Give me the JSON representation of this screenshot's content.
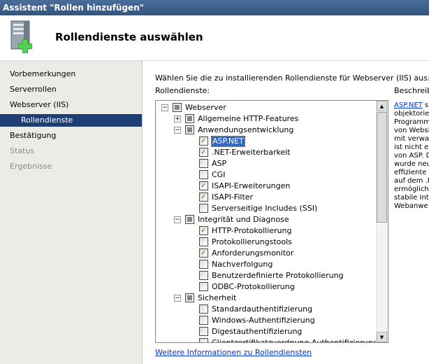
{
  "window": {
    "title": "Assistent \"Rollen hinzufügen\""
  },
  "header": {
    "title": "Rollendienste auswählen",
    "icon": "server-add-icon"
  },
  "sidebar": {
    "items": [
      {
        "label": "Vorbemerkungen",
        "state": "normal"
      },
      {
        "label": "Serverrollen",
        "state": "normal"
      },
      {
        "label": "Webserver (IIS)",
        "state": "normal"
      },
      {
        "label": "Rollendienste",
        "state": "selected"
      },
      {
        "label": "Bestätigung",
        "state": "normal"
      },
      {
        "label": "Status",
        "state": "disabled"
      },
      {
        "label": "Ergebnisse",
        "state": "disabled"
      }
    ]
  },
  "main": {
    "instruction": "Wählen Sie die zu installierenden Rollendienste für Webserver (IIS) aus:",
    "services_label": "Rollendienste:",
    "description_label": "Beschreib",
    "description_link": "ASP.NET",
    "description_lines": [
      " s",
      "objektorie",
      "Programm",
      "von Websi",
      "mit verwa",
      "ist nicht e",
      "von ASP. D",
      "wurde neu",
      "effiziente",
      "auf dem .N",
      "ermöglich",
      "stabile Int",
      "Webanwe"
    ],
    "more_info_link": "Weitere Informationen zu Rollendiensten"
  },
  "tree": [
    {
      "label": "Webserver",
      "level": 0,
      "expander": "−",
      "check": "partial"
    },
    {
      "label": "Allgemeine HTTP-Features",
      "level": 1,
      "expander": "+",
      "check": "partial"
    },
    {
      "label": "Anwendungsentwicklung",
      "level": 1,
      "expander": "−",
      "check": "partial"
    },
    {
      "label": "ASP.NET",
      "level": 2,
      "check": "checked",
      "selected": true
    },
    {
      "label": ".NET-Erweiterbarkeit",
      "level": 2,
      "check": "checked"
    },
    {
      "label": "ASP",
      "level": 2,
      "check": "unchecked"
    },
    {
      "label": "CGI",
      "level": 2,
      "check": "unchecked"
    },
    {
      "label": "ISAPI-Erweiterungen",
      "level": 2,
      "check": "checked"
    },
    {
      "label": "ISAPI-Filter",
      "level": 2,
      "check": "checked"
    },
    {
      "label": "Serverseitige Includes (SSI)",
      "level": 2,
      "check": "unchecked"
    },
    {
      "label": "Integrität und Diagnose",
      "level": 1,
      "expander": "−",
      "check": "partial"
    },
    {
      "label": "HTTP-Protokollierung",
      "level": 2,
      "check": "checked"
    },
    {
      "label": "Protokollierungstools",
      "level": 2,
      "check": "unchecked"
    },
    {
      "label": "Anforderungsmonitor",
      "level": 2,
      "check": "checked"
    },
    {
      "label": "Nachverfolgung",
      "level": 2,
      "check": "unchecked"
    },
    {
      "label": "Benutzerdefinierte Protokollierung",
      "level": 2,
      "check": "unchecked"
    },
    {
      "label": "ODBC-Protokollierung",
      "level": 2,
      "check": "unchecked"
    },
    {
      "label": "Sicherheit",
      "level": 1,
      "expander": "−",
      "check": "partial"
    },
    {
      "label": "Standardauthentifizierung",
      "level": 2,
      "check": "unchecked"
    },
    {
      "label": "Windows-Authentifizierung",
      "level": 2,
      "check": "unchecked"
    },
    {
      "label": "Digestauthentifizierung",
      "level": 2,
      "check": "unchecked"
    },
    {
      "label": "Clientzertifikatzuordnung-Authentifizierung",
      "level": 2,
      "check": "unchecked"
    }
  ],
  "scrollbar": {
    "up_glyph": "▲",
    "down_glyph": "▼"
  },
  "colors": {
    "titlebar": "#33557f",
    "selected_nav": "#1f3f74",
    "link": "#0033cc",
    "check": "#21a121"
  }
}
